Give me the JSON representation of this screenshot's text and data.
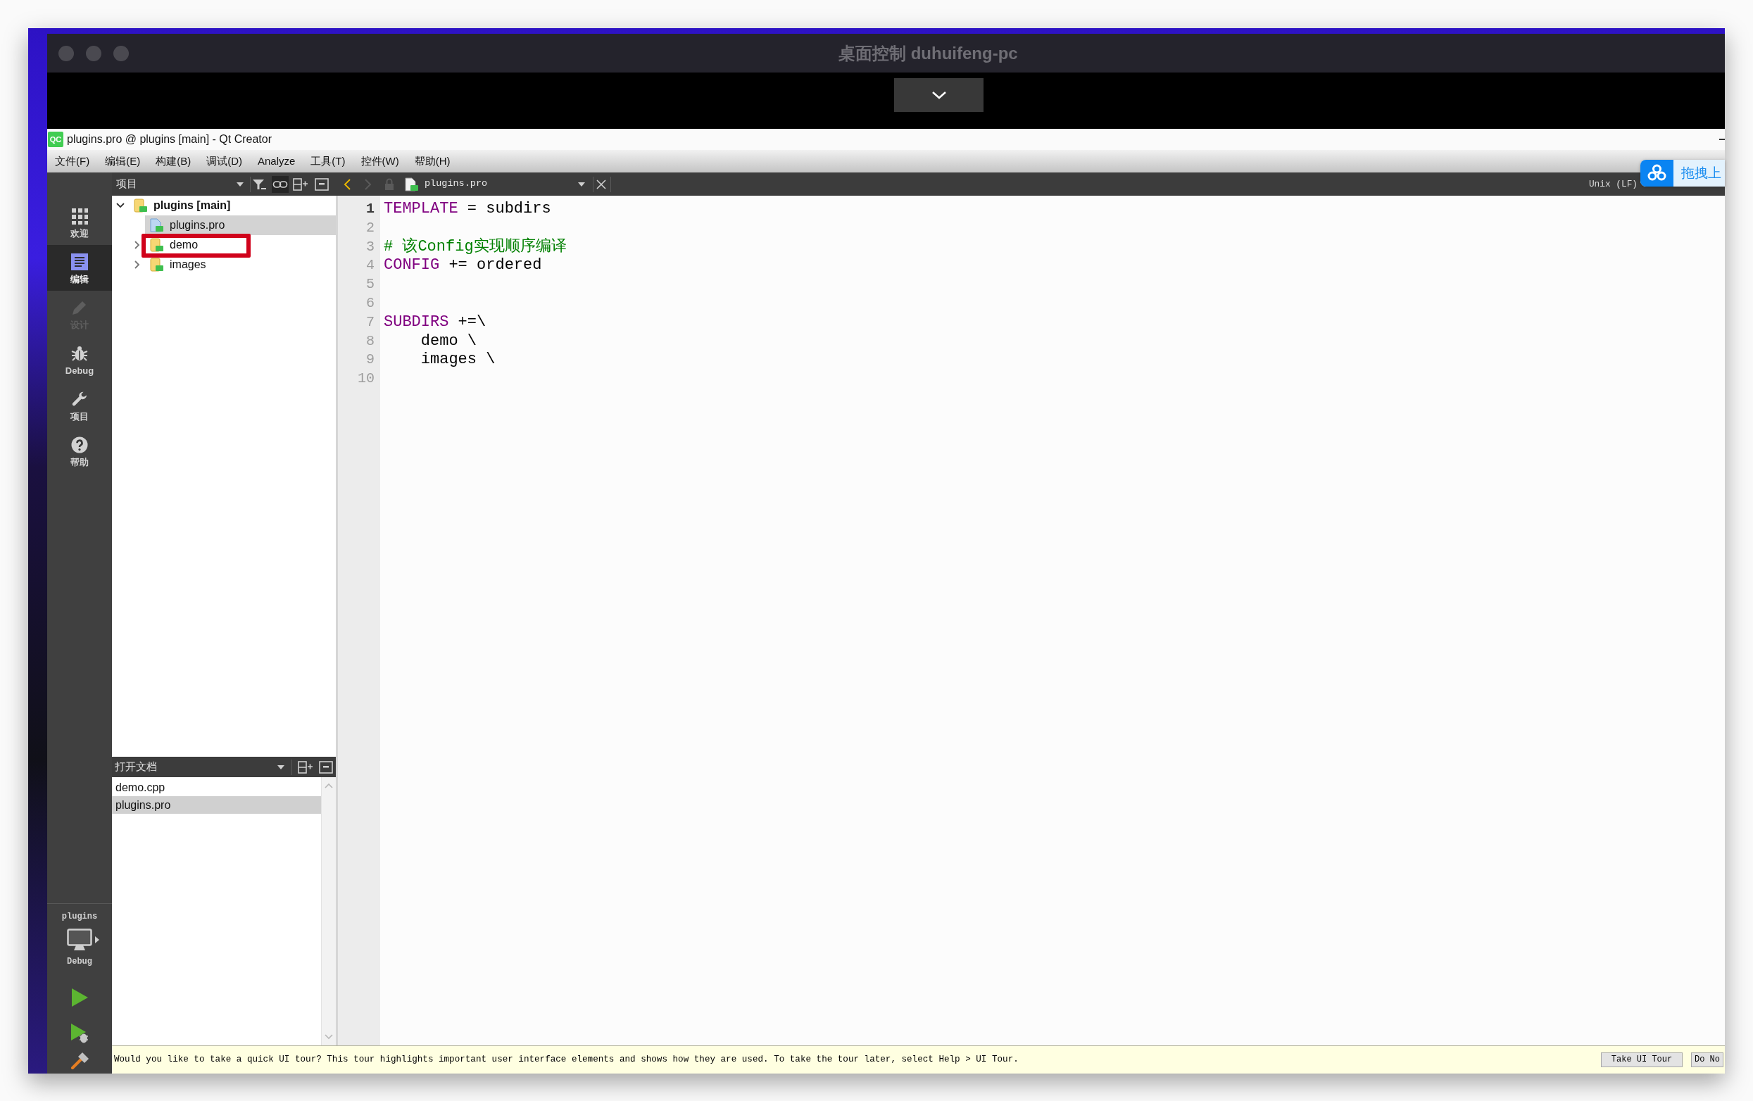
{
  "remote_window": {
    "title": "桌面控制 duhuifeng-pc"
  },
  "qt_window": {
    "logo": "QC",
    "title": "plugins.pro @ plugins [main] - Qt Creator"
  },
  "menu_bar": [
    "文件(F)",
    "编辑(E)",
    "构建(B)",
    "调试(D)",
    "Analyze",
    "工具(T)",
    "控件(W)",
    "帮助(H)"
  ],
  "mode_bar": {
    "modes": [
      {
        "label": "欢迎",
        "kind": "grid",
        "selected": false,
        "disabled": false
      },
      {
        "label": "编辑",
        "kind": "document",
        "selected": true,
        "disabled": false
      },
      {
        "label": "设计",
        "kind": "pencil",
        "selected": false,
        "disabled": true
      },
      {
        "label": "Debug",
        "kind": "bug",
        "selected": false,
        "disabled": false
      },
      {
        "label": "项目",
        "kind": "wrench",
        "selected": false,
        "disabled": false
      },
      {
        "label": "帮助",
        "kind": "help",
        "selected": false,
        "disabled": false
      }
    ],
    "project": "plugins",
    "build_config": "Debug"
  },
  "project_panel": {
    "view": "项目",
    "link_toggle_checked": true,
    "tree": [
      {
        "label": "plugins [main]",
        "kind": "project",
        "expanded": true,
        "selected": false,
        "annotated": false,
        "children": [
          {
            "label": "plugins.pro",
            "kind": "file",
            "selected": true,
            "annotated": false
          },
          {
            "label": "demo",
            "kind": "folder",
            "expanded": false,
            "selected": false,
            "annotated": true
          },
          {
            "label": "images",
            "kind": "folder",
            "expanded": false,
            "selected": false,
            "annotated": false
          }
        ]
      }
    ]
  },
  "open_documents": {
    "title": "打开文档",
    "items": [
      {
        "label": "demo.cpp",
        "selected": false
      },
      {
        "label": "plugins.pro",
        "selected": true
      }
    ]
  },
  "editor": {
    "back_enabled": true,
    "forward_enabled": false,
    "document": "plugins.pro",
    "line_ending": "Unix (LF)",
    "lines": [
      {
        "number": "1",
        "current": true,
        "segments": [
          {
            "kind": "keyword",
            "text": "TEMPLATE"
          },
          {
            "kind": "plain",
            "text": " = subdirs"
          }
        ]
      },
      {
        "number": "2",
        "current": false
      },
      {
        "number": "3",
        "current": false,
        "segments": [
          {
            "kind": "comment",
            "text": "# 该Config实现顺序编译"
          }
        ]
      },
      {
        "number": "4",
        "current": false,
        "segments": [
          {
            "kind": "keyword",
            "text": "CONFIG"
          },
          {
            "kind": "plain",
            "text": " += ordered"
          }
        ]
      },
      {
        "number": "5",
        "current": false
      },
      {
        "number": "6",
        "current": false
      },
      {
        "number": "7",
        "current": false,
        "segments": [
          {
            "kind": "keyword",
            "text": "SUBDIRS"
          },
          {
            "kind": "plain",
            "text": " +=\\"
          }
        ]
      },
      {
        "number": "8",
        "current": false,
        "segments": [
          {
            "kind": "plain",
            "text": "    demo \\"
          }
        ]
      },
      {
        "number": "9",
        "current": false,
        "segments": [
          {
            "kind": "plain",
            "text": "    images \\"
          }
        ]
      },
      {
        "number": "10",
        "current": false
      }
    ]
  },
  "info_bar": {
    "message": "Would you like to take a quick UI tour? This tour highlights important user interface elements and shows how they are used. To take the tour later, select Help > UI Tour.",
    "buttons": [
      "Take UI Tour",
      "Do No"
    ]
  },
  "upload_widget": {
    "label": "拖拽上"
  }
}
